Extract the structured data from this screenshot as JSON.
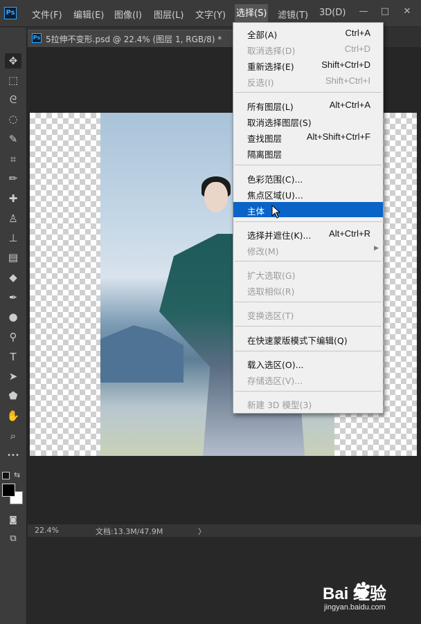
{
  "app": {
    "logo": "Ps"
  },
  "menubar": {
    "items": [
      {
        "label": "文件(F)"
      },
      {
        "label": "编辑(E)"
      },
      {
        "label": "图像(I)"
      },
      {
        "label": "图层(L)"
      },
      {
        "label": "文字(Y)"
      },
      {
        "label": "选择(S)"
      },
      {
        "label": "滤镜(T)"
      },
      {
        "label": "3D(D)"
      }
    ],
    "window_buttons": {
      "minimize": "—",
      "restore": "□",
      "close": "✕"
    }
  },
  "document": {
    "tab_title": "5拉伸不变形.psd @ 22.4% (图层 1, RGB/8) *"
  },
  "status": {
    "zoom": "22.4%",
    "doc_info": "文档:13.3M/47.9M",
    "arrow": "〉"
  },
  "select_menu": {
    "items": [
      {
        "label": "全部(A)",
        "shortcut": "Ctrl+A",
        "enabled": true
      },
      {
        "label": "取消选择(D)",
        "shortcut": "Ctrl+D",
        "enabled": false
      },
      {
        "label": "重新选择(E)",
        "shortcut": "Shift+Ctrl+D",
        "enabled": true
      },
      {
        "label": "反选(I)",
        "shortcut": "Shift+Ctrl+I",
        "enabled": false
      },
      {
        "label": "所有图层(L)",
        "shortcut": "Alt+Ctrl+A",
        "enabled": true
      },
      {
        "label": "取消选择图层(S)",
        "shortcut": "",
        "enabled": true
      },
      {
        "label": "查找图层",
        "shortcut": "Alt+Shift+Ctrl+F",
        "enabled": true
      },
      {
        "label": "隔离图层",
        "shortcut": "",
        "enabled": true
      },
      {
        "label": "色彩范围(C)...",
        "shortcut": "",
        "enabled": true
      },
      {
        "label": "焦点区域(U)...",
        "shortcut": "",
        "enabled": true
      },
      {
        "label": "主体",
        "shortcut": "",
        "enabled": true,
        "highlighted": true
      },
      {
        "label": "选择并遮住(K)...",
        "shortcut": "Alt+Ctrl+R",
        "enabled": true
      },
      {
        "label": "修改(M)",
        "shortcut": "",
        "enabled": false,
        "submenu": true
      },
      {
        "label": "扩大选取(G)",
        "shortcut": "",
        "enabled": false
      },
      {
        "label": "选取相似(R)",
        "shortcut": "",
        "enabled": false
      },
      {
        "label": "变换选区(T)",
        "shortcut": "",
        "enabled": false
      },
      {
        "label": "在快速蒙版模式下编辑(Q)",
        "shortcut": "",
        "enabled": true
      },
      {
        "label": "载入选区(O)...",
        "shortcut": "",
        "enabled": true
      },
      {
        "label": "存储选区(V)...",
        "shortcut": "",
        "enabled": false
      },
      {
        "label": "新建 3D 模型(3)",
        "shortcut": "",
        "enabled": false
      }
    ],
    "submenu_arrow": "▶"
  },
  "tools": [
    {
      "icon": "move-tool-icon",
      "glyph": "✥"
    },
    {
      "icon": "marquee-tool-icon",
      "glyph": "⬚"
    },
    {
      "icon": "lasso-tool-icon",
      "glyph": "ᘓ"
    },
    {
      "icon": "quick-select-tool-icon",
      "glyph": "◌"
    },
    {
      "icon": "eyedropper-tool-icon",
      "glyph": "✎"
    },
    {
      "icon": "crop-tool-icon",
      "glyph": "⌗"
    },
    {
      "icon": "brush-tool-icon",
      "glyph": "✏"
    },
    {
      "icon": "spot-healing-tool-icon",
      "glyph": "✚"
    },
    {
      "icon": "clone-stamp-tool-icon",
      "glyph": "♙"
    },
    {
      "icon": "stamp-tool-icon",
      "glyph": "⊥"
    },
    {
      "icon": "gradient-tool-icon",
      "glyph": "▤"
    },
    {
      "icon": "eraser-tool-icon",
      "glyph": "◆"
    },
    {
      "icon": "pen-tool-icon",
      "glyph": "✒"
    },
    {
      "icon": "blur-tool-icon",
      "glyph": "●"
    },
    {
      "icon": "dodge-tool-icon",
      "glyph": "⚲"
    },
    {
      "icon": "type-tool-icon",
      "glyph": "T"
    },
    {
      "icon": "path-select-tool-icon",
      "glyph": "➤"
    },
    {
      "icon": "shape-tool-icon",
      "glyph": "⬟"
    },
    {
      "icon": "hand-tool-icon",
      "glyph": "✋"
    },
    {
      "icon": "zoom-tool-icon",
      "glyph": "⌕"
    },
    {
      "icon": "more-tools-icon",
      "glyph": "•••"
    }
  ],
  "watermark": {
    "brand": "Bai  经验",
    "url": "jingyan.baidu.com"
  },
  "colors": {
    "highlight": "#0a64c8",
    "ps_blue": "#31a8ff"
  }
}
